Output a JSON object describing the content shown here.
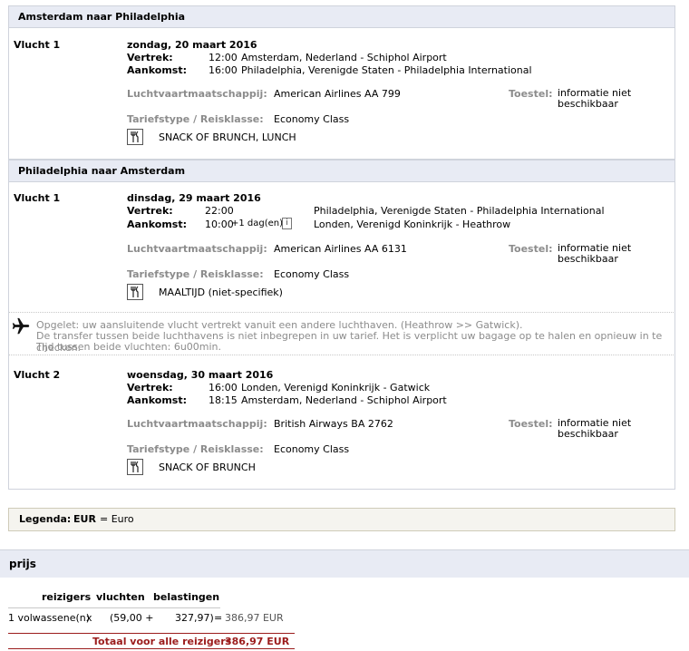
{
  "segments": [
    {
      "route": "Amsterdam naar Philadelphia",
      "flights": [
        {
          "label": "Vlucht 1",
          "date": "zondag, 20 maart 2016",
          "departure_label": "Vertrek:",
          "departure_time": "12:00",
          "departure_place": "Amsterdam, Nederland - Schiphol Airport",
          "arrival_label": "Aankomst:",
          "arrival_time": "16:00",
          "arrival_place": "Philadelphia, Verenigde Staten - Philadelphia International",
          "airline_label": "Luchtvaartmaatschappij:",
          "airline": "American Airlines AA 799",
          "aircraft_label": "Toestel:",
          "aircraft": "informatie niet beschikbaar",
          "fare_label": "Tariefstype / Reisklasse:",
          "fare": "Economy Class",
          "meal": "SNACK OF BRUNCH, LUNCH",
          "meal_icon": "fork-knife-icon"
        }
      ]
    },
    {
      "route": "Philadelphia naar Amsterdam",
      "flights": [
        {
          "label": "Vlucht 1",
          "date": "dinsdag, 29 maart 2016",
          "departure_label": "Vertrek:",
          "departure_time": "22:00",
          "departure_place": "Philadelphia, Verenigde Staten - Philadelphia International",
          "arrival_label": "Aankomst:",
          "arrival_time": "10:00",
          "arrival_day_offset": "+1 dag(en)",
          "info_icon": "i",
          "arrival_place": "Londen, Verenigd Koninkrijk - Heathrow",
          "airline_label": "Luchtvaartmaatschappij:",
          "airline": "American Airlines AA 6131",
          "aircraft_label": "Toestel:",
          "aircraft": "informatie niet beschikbaar",
          "fare_label": "Tariefstype / Reisklasse:",
          "fare": "Economy Class",
          "meal": "MAALTIJD (niet-specifiek)",
          "meal_icon": "fork-knife-icon"
        },
        {
          "label": "Vlucht 2",
          "date": "woensdag, 30 maart 2016",
          "departure_label": "Vertrek:",
          "departure_time": "16:00",
          "departure_place": "Londen, Verenigd Koninkrijk - Gatwick",
          "arrival_label": "Aankomst:",
          "arrival_time": "18:15",
          "arrival_place": "Amsterdam, Nederland - Schiphol Airport",
          "airline_label": "Luchtvaartmaatschappij:",
          "airline": "British Airways BA 2762",
          "aircraft_label": "Toestel:",
          "aircraft": "informatie niet beschikbaar",
          "fare_label": "Tariefstype / Reisklasse:",
          "fare": "Economy Class",
          "meal": "SNACK OF BRUNCH",
          "meal_icon": "fork-knife-icon"
        }
      ],
      "transfer_warning": {
        "icon": "airplane-icon",
        "line1": "Opgelet: uw aansluitende vlucht vertrekt vanuit een andere luchthaven. (Heathrow >> Gatwick).",
        "line2": "De transfer tussen beide luchthavens is niet inbegrepen in uw tarief. Het is verplicht uw bagage op te halen en opnieuw in te checken.",
        "line3": "Tijd tussen beide vluchten: 6u00min."
      }
    }
  ],
  "legend": {
    "label": "Legenda:",
    "currency_code": "EUR",
    "currency_text": "= Euro"
  },
  "price": {
    "title": "prijs",
    "col_travelers": "reizigers",
    "col_flights": "vluchten",
    "col_taxes": "belastingen",
    "row_travelers": "1 volwassene(n)",
    "row_times": "x",
    "row_flights": "(59,00 +",
    "row_taxes": "327,97)",
    "row_equals": "=",
    "row_total": "386,97 EUR",
    "total_label": "Totaal voor alle reizigers",
    "total_value": "386,97 EUR"
  },
  "colors": {
    "section_header_bg": "#e8ebf4",
    "accent_red": "#9b1c1c",
    "legend_bg": "#f5f4ef"
  }
}
